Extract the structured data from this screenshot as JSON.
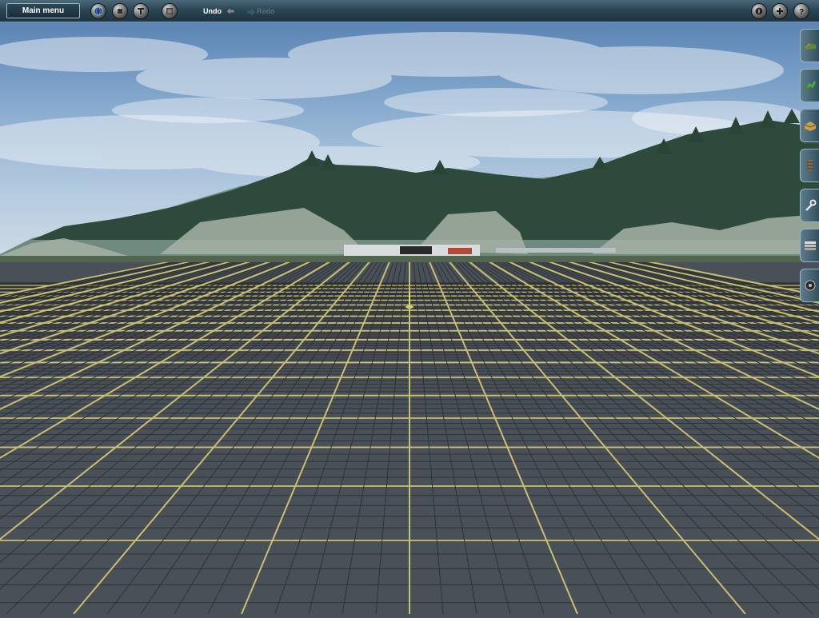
{
  "toolbar": {
    "main_menu_label": "Main menu",
    "undo_label": "Undo",
    "redo_label": "Redo",
    "left_icons": [
      "globe-icon",
      "stop-icon",
      "text-icon",
      "layers-icon"
    ],
    "right_icons": [
      "compass-icon",
      "add-icon",
      "help-icon"
    ]
  },
  "side_panel": {
    "tabs": [
      "terrain-tool-icon",
      "trackside-tool-icon",
      "objects-tool-icon",
      "track-tool-icon",
      "wrench-tool-icon",
      "layers-tool-icon",
      "settings-tool-icon"
    ]
  },
  "colors": {
    "toolbar_bg": "#2c4654",
    "grid_fill": "#4a5058",
    "grid_line": "#c8c070",
    "sky_top": "#5c84b4",
    "forest": "#2e4a3c"
  }
}
